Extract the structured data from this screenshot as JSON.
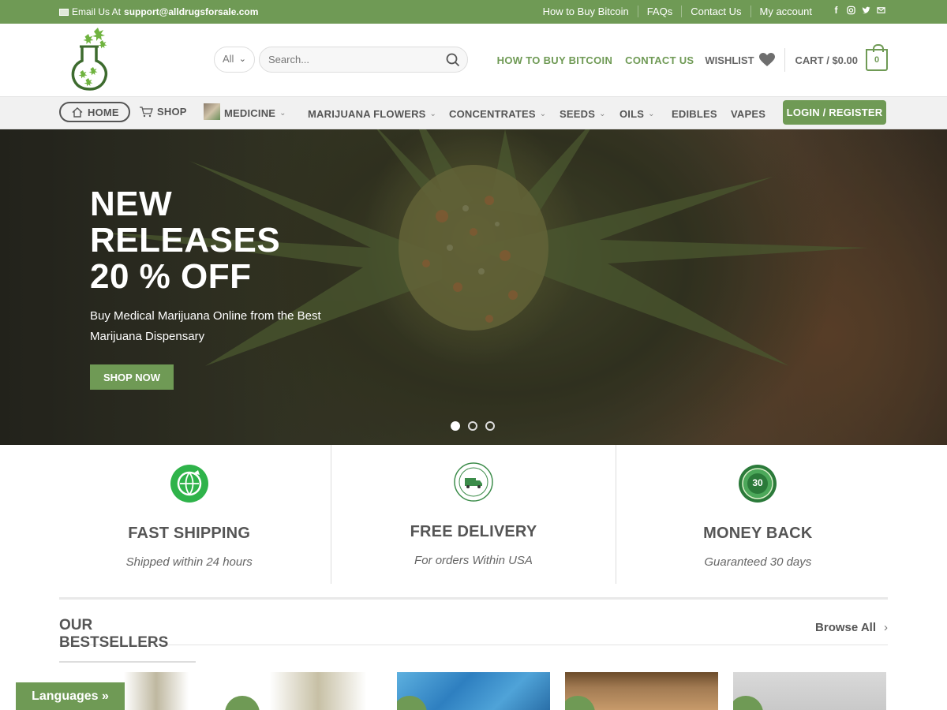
{
  "topbar": {
    "email_label": "Email Us At",
    "email": "support@alldrugsforsale.com",
    "links": [
      "How to Buy Bitcoin",
      "FAQs",
      "Contact Us",
      "My account"
    ],
    "socials": [
      "facebook-icon",
      "instagram-icon",
      "twitter-icon",
      "email-icon"
    ]
  },
  "header": {
    "search": {
      "category": "All",
      "placeholder": "Search..."
    },
    "how_to_buy": "HOW TO BUY BITCOIN",
    "contact": "CONTACT US",
    "wishlist": "WISHLIST",
    "cart": "CART / $0.00",
    "cart_count": "0"
  },
  "nav": {
    "home": "HOME",
    "shop": "SHOP",
    "medicine": "MEDICINE",
    "flowers": "MARIJUANA FLOWERS",
    "concentrates": "CONCENTRATES",
    "seeds": "SEEDS",
    "oils": "OILS",
    "edibles": "EDIBLES",
    "vapes": "VAPES",
    "login": "LOGIN / REGISTER"
  },
  "hero": {
    "title_line1": "NEW",
    "title_line2": "RELEASES",
    "title_line3": "20 % OFF",
    "subtitle": "Buy Medical Marijuana Online from the Best Marijuana Dispensary",
    "button": "SHOP NOW",
    "slides": 3,
    "active_slide": 1
  },
  "features": [
    {
      "title": "FAST SHIPPING",
      "subtitle": "Shipped within 24 hours",
      "icon": "globe-shipping-icon"
    },
    {
      "title": "FREE DELIVERY",
      "subtitle": "For orders Within USA",
      "icon": "free-delivery-truck-icon"
    },
    {
      "title": "MONEY BACK",
      "subtitle": "Guaranteed 30 days",
      "icon": "30-days-badge-icon"
    }
  ],
  "bestsellers": {
    "title": "OUR BESTSELLERS",
    "browse": "Browse All"
  },
  "languages": "Languages »",
  "colors": {
    "accent": "#6f9a55",
    "text": "#555555"
  }
}
